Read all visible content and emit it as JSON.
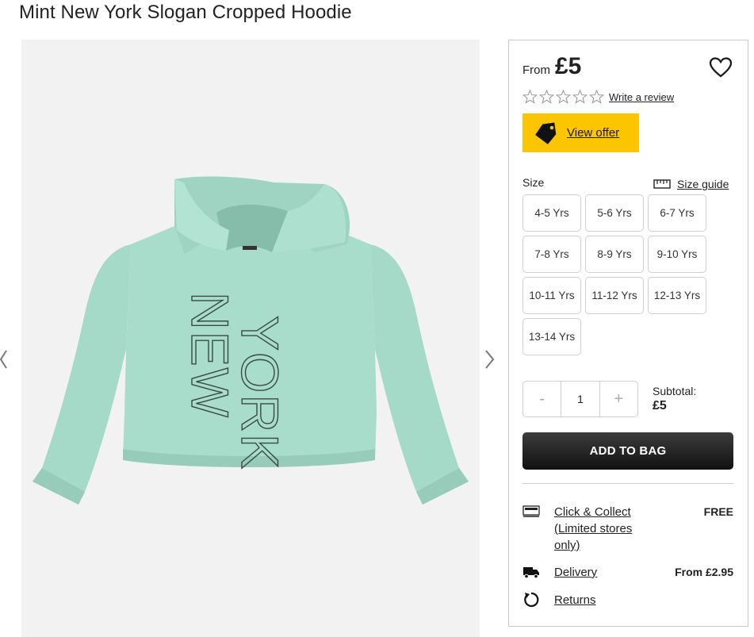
{
  "product": {
    "title": "Mint New York Slogan Cropped Hoodie",
    "image_icon": "hoodie-product-photo",
    "hoodie_color": "#a8dccb",
    "print_text": [
      "NEW",
      "YORK"
    ]
  },
  "price": {
    "from_label": "From",
    "value": "£5"
  },
  "rating": {
    "stars": 0,
    "max_stars": 5,
    "review_link": "Write a review"
  },
  "offer": {
    "label": "View offer",
    "color": "#fbc600"
  },
  "size": {
    "label": "Size",
    "guide_label": "Size guide",
    "options": [
      "4-5 Yrs",
      "5-6 Yrs",
      "6-7 Yrs",
      "7-8 Yrs",
      "8-9 Yrs",
      "9-10 Yrs",
      "10-11 Yrs",
      "11-12 Yrs",
      "12-13 Yrs",
      "13-14 Yrs"
    ]
  },
  "quantity": {
    "minus": "-",
    "value": "1",
    "plus": "+"
  },
  "subtotal": {
    "label": "Subtotal:",
    "value": "£5"
  },
  "add_to_bag": "ADD TO BAG",
  "fulfilment": {
    "collect": {
      "label": "Click & Collect (Limited stores only)",
      "value": "FREE",
      "icon": "store-icon"
    },
    "delivery": {
      "label": "Delivery",
      "value": "From £2.95",
      "icon": "truck-icon"
    },
    "returns": {
      "label": "Returns",
      "icon": "returns-icon"
    }
  }
}
